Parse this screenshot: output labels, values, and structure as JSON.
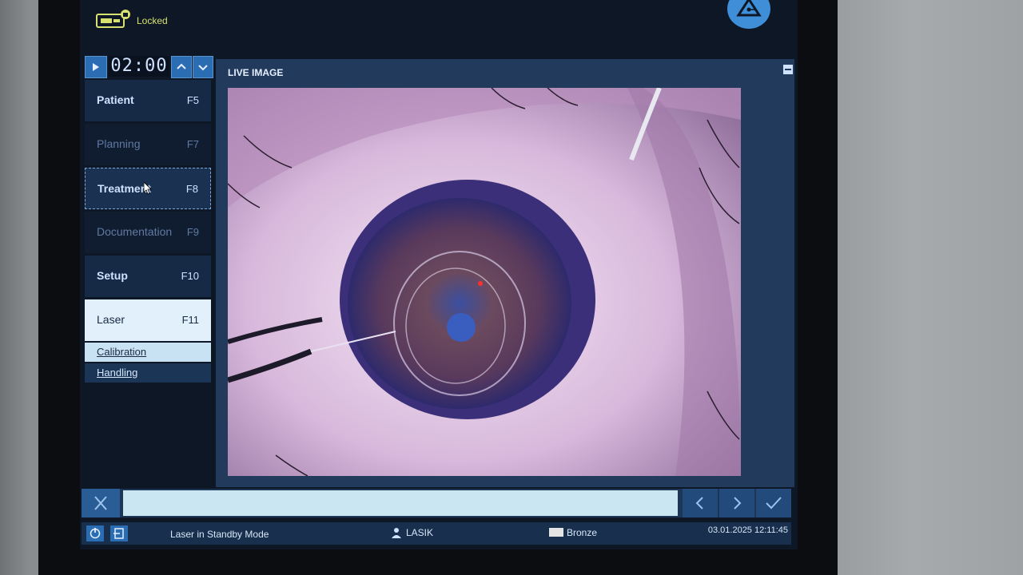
{
  "top": {
    "lock_status": "Locked"
  },
  "timer": {
    "value": "02:00"
  },
  "nav": {
    "items": [
      {
        "label": "Patient",
        "key": "F5"
      },
      {
        "label": "Planning",
        "key": "F7"
      },
      {
        "label": "Treatment",
        "key": "F8"
      },
      {
        "label": "Documentation",
        "key": "F9"
      },
      {
        "label": "Setup",
        "key": "F10"
      },
      {
        "label": "Laser",
        "key": "F11"
      }
    ],
    "subitems": [
      {
        "label": "Calibration"
      },
      {
        "label": "Handling"
      }
    ]
  },
  "panel": {
    "title": "LIVE IMAGE"
  },
  "status": {
    "message": "Laser in Standby Mode",
    "user": "LASIK",
    "level": "Bronze",
    "datetime": "03.01.2025 12:11:45"
  },
  "colors": {
    "accent": "#2b6db2",
    "lock_text": "#d8e070",
    "active_nav": "#e1f0fa",
    "progress_fill": "#c9e6f2"
  }
}
